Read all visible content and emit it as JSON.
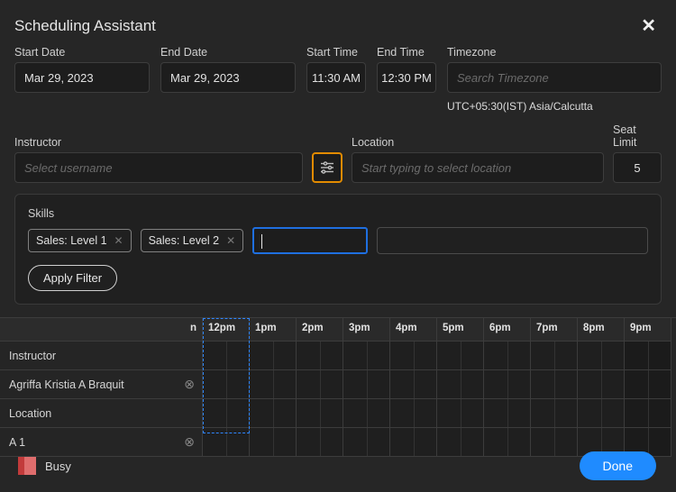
{
  "title": "Scheduling Assistant",
  "fields": {
    "startDate": {
      "label": "Start Date",
      "value": "Mar 29, 2023"
    },
    "endDate": {
      "label": "End Date",
      "value": "Mar 29, 2023"
    },
    "startTime": {
      "label": "Start Time",
      "value": "11:30 AM"
    },
    "endTime": {
      "label": "End Time",
      "value": "12:30 PM"
    },
    "timezone": {
      "label": "Timezone",
      "placeholder": "Search Timezone",
      "display": "UTC+05:30(IST) Asia/Calcutta"
    },
    "instructor": {
      "label": "Instructor",
      "placeholder": "Select username"
    },
    "location": {
      "label": "Location",
      "placeholder": "Start typing to select location"
    },
    "seatLimit": {
      "label": "Seat Limit",
      "value": "5"
    }
  },
  "skills": {
    "label": "Skills",
    "chips": [
      "Sales: Level 1",
      "Sales: Level 2"
    ],
    "applyLabel": "Apply Filter"
  },
  "grid": {
    "leadHour": "n",
    "hours": [
      "12pm",
      "1pm",
      "2pm",
      "3pm",
      "4pm",
      "5pm",
      "6pm",
      "7pm",
      "8pm",
      "9pm"
    ],
    "rows": [
      {
        "label": "Instructor",
        "removable": false
      },
      {
        "label": "Agriffa Kristia A Braquit",
        "removable": true
      },
      {
        "label": "Location",
        "removable": false
      },
      {
        "label": "A 1",
        "removable": true
      }
    ]
  },
  "legend": {
    "busy": "Busy"
  },
  "doneLabel": "Done"
}
